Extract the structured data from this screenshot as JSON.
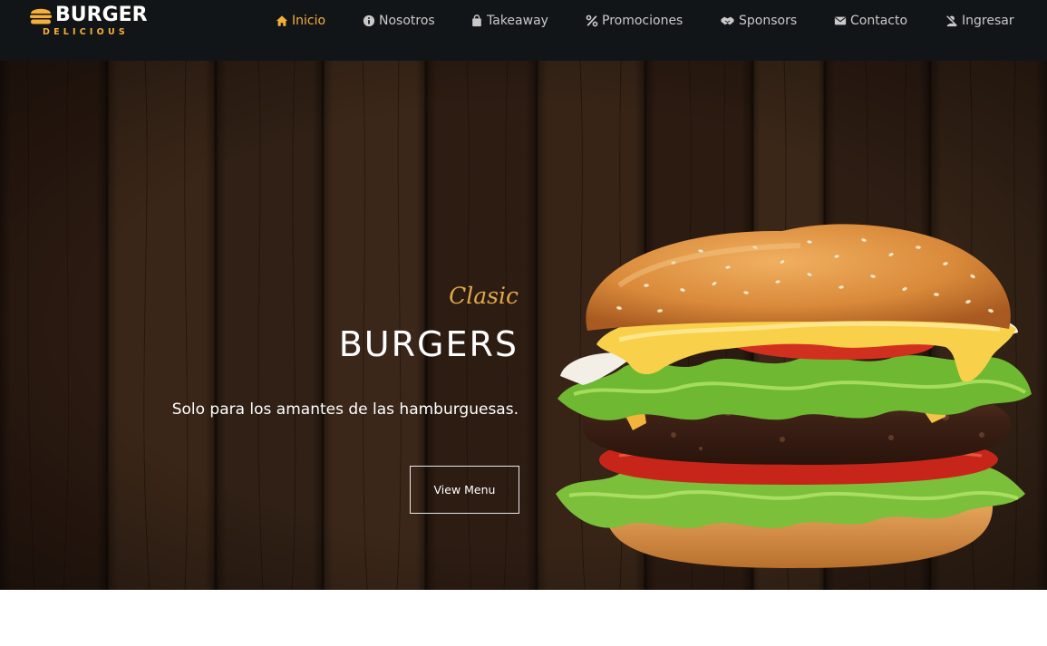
{
  "header": {
    "logo": {
      "title": "BURGER",
      "subtitle": "DELICIOUS",
      "icon": "burger-icon"
    },
    "nav": [
      {
        "label": "Inicio",
        "icon": "home-icon",
        "active": true
      },
      {
        "label": "Nosotros",
        "icon": "info-circle-icon",
        "active": false
      },
      {
        "label": "Takeaway",
        "icon": "shopping-bag-icon",
        "active": false
      },
      {
        "label": "Promociones",
        "icon": "percent-icon",
        "active": false
      },
      {
        "label": "Sponsors",
        "icon": "handshake-icon",
        "active": false
      },
      {
        "label": "Contacto",
        "icon": "envelope-icon",
        "active": false
      },
      {
        "label": "Ingresar",
        "icon": "user-lock-icon",
        "active": false
      }
    ]
  },
  "hero": {
    "tagline": "Clasic",
    "title": "BURGERS",
    "subtitle": "Solo para los amantes de las hamburguesas.",
    "button_label": "View Menu",
    "image": "burger-image"
  },
  "colors": {
    "nav_bg": "#121517",
    "accent": "#f4b03a",
    "nav_text": "#c9c9c9",
    "hero_bg": "#2e1c12"
  }
}
